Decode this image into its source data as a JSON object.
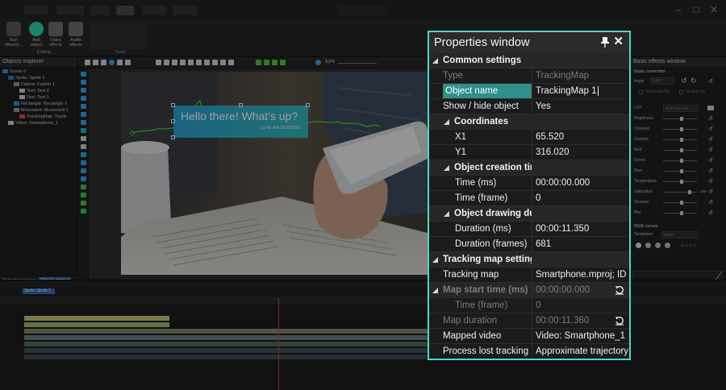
{
  "ribbon": {
    "run_wizard": "Run Wizard...",
    "add_object": "Add object",
    "video_effects": "Video effects",
    "audio_effects": "Audio effects",
    "group_editing": "Editing",
    "group_tools": "Tools"
  },
  "objects_explorer": {
    "title": "Objects explorer",
    "items": [
      {
        "label": "Scene 0",
        "indent": 0,
        "color": "#3a8bd8"
      },
      {
        "label": "Sprite: Sprite 1",
        "indent": 1,
        "color": "#2e7bd1"
      },
      {
        "label": "FadeIn: FadeIn 1",
        "indent": 2,
        "color": "#9a9a9a"
      },
      {
        "label": "Text: Text 2",
        "indent": 3,
        "color": "#d0d0d0"
      },
      {
        "label": "Text: Text 1",
        "indent": 3,
        "color": "#d0d0d0"
      },
      {
        "label": "Rectangle: Rectangle 1",
        "indent": 2,
        "color": "#2aa1d8"
      },
      {
        "label": "Movement: Movement 1",
        "indent": 2,
        "color": "#9a9a9a"
      },
      {
        "label": "TrackingMap: Tracki",
        "indent": 3,
        "color": "#d84b4b"
      },
      {
        "label": "Video: Smartphone_1",
        "indent": 1,
        "color": "#d0d0d0"
      }
    ],
    "tab_properties": "Properties explorer",
    "tab_objects": "Objects explorer"
  },
  "canvas": {
    "zoom": "51%",
    "bubble_message": "Hello there! What's up?",
    "bubble_timestamp": "11:42 AM 2/19/2020"
  },
  "right_panel": {
    "title": "Basic effects window",
    "section_basic": "Basic correction",
    "angle_label": "Angle",
    "angle_value": "0.00 °",
    "horizontal_flip": "Horizontal flip",
    "vertical_flip": "Vertical flip",
    "lut_label": "LUT",
    "lut_value": "Don't use LUT",
    "sliders": [
      {
        "label": "Brightness",
        "pos": 0.55
      },
      {
        "label": "Contrast",
        "pos": 0.55
      },
      {
        "label": "Gamma",
        "pos": 0.55
      },
      {
        "label": "Red",
        "pos": 0.55
      },
      {
        "label": "Green",
        "pos": 0.55
      },
      {
        "label": "Blue",
        "pos": 0.55
      },
      {
        "label": "Temperature",
        "pos": 0.55
      },
      {
        "label": "Saturation",
        "pos": 0.78
      },
      {
        "label": "Sharpen",
        "pos": 0.55
      },
      {
        "label": "Blur",
        "pos": 0.55
      }
    ],
    "saturation_value": "100",
    "section_rgb": "RGB curves",
    "templates_label": "Templates:",
    "templates_value": "None",
    "curve_coords": "X: 0, Y: 0"
  },
  "properties": {
    "title": "Properties window",
    "rows": [
      {
        "kind": "section",
        "level": 0,
        "key": "Common settings"
      },
      {
        "kind": "prop",
        "level": 0,
        "key": "Type",
        "value": "TrackingMap",
        "disabled": true
      },
      {
        "kind": "prop",
        "level": 0,
        "key": "Object name",
        "value": "TrackingMap 1",
        "selected": true,
        "editing": true
      },
      {
        "kind": "prop",
        "level": 0,
        "key": "Show / hide object",
        "value": "Yes"
      },
      {
        "kind": "section",
        "level": 1,
        "key": "Coordinates"
      },
      {
        "kind": "prop",
        "level": 1,
        "key": "X1",
        "value": "65.520"
      },
      {
        "kind": "prop",
        "level": 1,
        "key": "Y1",
        "value": "316.020"
      },
      {
        "kind": "section",
        "level": 1,
        "key": "Object creation time"
      },
      {
        "kind": "prop",
        "level": 1,
        "key": "Time (ms)",
        "value": "00:00:00.000"
      },
      {
        "kind": "prop",
        "level": 1,
        "key": "Time (frame)",
        "value": "0"
      },
      {
        "kind": "section",
        "level": 1,
        "key": "Object drawing duration"
      },
      {
        "kind": "prop",
        "level": 1,
        "key": "Duration (ms)",
        "value": "00:00:11.350"
      },
      {
        "kind": "prop",
        "level": 1,
        "key": "Duration (frames)",
        "value": "681"
      },
      {
        "kind": "section",
        "level": 0,
        "key": "Tracking map settings"
      },
      {
        "kind": "prop",
        "level": 0,
        "key": "Tracking map",
        "value": "Smartphone.mproj; ID"
      },
      {
        "kind": "section",
        "level": 0,
        "key": "Map start time (ms)",
        "value": "00:00:00.000",
        "disabled": true,
        "reset": true
      },
      {
        "kind": "prop",
        "level": 1,
        "key": "Time (frame)",
        "value": "0",
        "disabled": true
      },
      {
        "kind": "prop",
        "level": 0,
        "key": "Map duration",
        "value": "00:00:11.360",
        "disabled": true,
        "reset": true
      },
      {
        "kind": "prop",
        "level": 0,
        "key": "Mapped video",
        "value": "Video: Smartphone_1"
      },
      {
        "kind": "prop",
        "level": 0,
        "key": "Process lost tracking",
        "value": "Approximate trajectory"
      }
    ]
  },
  "colors": {
    "accent": "#4fd6c8",
    "selection": "#2f8f8a",
    "bubble_left": "#2a9fd4",
    "bubble_right": "#35b7b8",
    "tracking_path": "#3fd02a"
  },
  "timeline": {
    "track_label": "Sprite: Sprite 1"
  }
}
